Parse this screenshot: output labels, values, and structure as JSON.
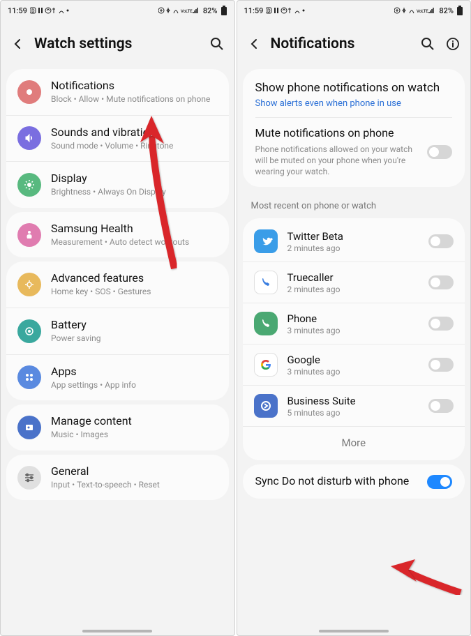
{
  "status": {
    "time": "11:59",
    "battery": "82%"
  },
  "left": {
    "title": "Watch settings",
    "items": [
      {
        "title": "Notifications",
        "sub": "Block • Allow • Mute notifications on phone"
      },
      {
        "title": "Sounds and vibration",
        "sub": "Sound mode • Volume • Ringtone"
      },
      {
        "title": "Display",
        "sub": "Brightness • Always On Display"
      },
      {
        "title": "Samsung Health",
        "sub": "Measurement • Auto detect workouts"
      },
      {
        "title": "Advanced features",
        "sub": "Home key • SOS • Gestures"
      },
      {
        "title": "Battery",
        "sub": "Power saving"
      },
      {
        "title": "Apps",
        "sub": "App settings • App info"
      },
      {
        "title": "Manage content",
        "sub": "Music • Images"
      },
      {
        "title": "General",
        "sub": "Input • Text-to-speech • Reset"
      }
    ]
  },
  "right": {
    "title": "Notifications",
    "show_panel": {
      "title": "Show phone notifications on watch",
      "link": "Show alerts even when phone in use"
    },
    "mute_panel": {
      "title": "Mute notifications on phone",
      "sub": "Phone notifications allowed on your watch will be muted on your phone when you're wearing your watch."
    },
    "section_label": "Most recent on phone or watch",
    "apps": [
      {
        "name": "Twitter Beta",
        "time": "2 minutes ago"
      },
      {
        "name": "Truecaller",
        "time": "2 minutes ago"
      },
      {
        "name": "Phone",
        "time": "3 minutes ago"
      },
      {
        "name": "Google",
        "time": "3 minutes ago"
      },
      {
        "name": "Business Suite",
        "time": "5 minutes ago"
      }
    ],
    "more": "More",
    "sync": {
      "title": "Sync Do not disturb with phone"
    }
  }
}
